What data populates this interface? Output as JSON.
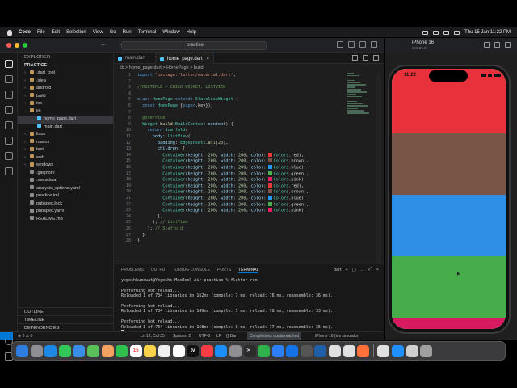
{
  "menubar": {
    "app": "Code",
    "items": [
      "File",
      "Edit",
      "Selection",
      "View",
      "Go",
      "Run",
      "Terminal",
      "Window",
      "Help"
    ],
    "datetime": "Thu 15 Jan  11:22 PM"
  },
  "titlebar": {
    "search": "practice"
  },
  "sidebar": {
    "header": "EXPLORER",
    "project": "PRACTICE",
    "tree": [
      {
        "label": ".dart_tool",
        "indent": 0,
        "folder": true
      },
      {
        "label": ".idea",
        "indent": 0,
        "folder": true
      },
      {
        "label": "android",
        "indent": 0,
        "folder": true
      },
      {
        "label": "build",
        "indent": 0,
        "folder": true
      },
      {
        "label": "ios",
        "indent": 0,
        "folder": true
      },
      {
        "label": "lib",
        "indent": 0,
        "folder": true,
        "open": true
      },
      {
        "label": "home_page.dart",
        "indent": 1,
        "selected": true
      },
      {
        "label": "main.dart",
        "indent": 1
      },
      {
        "label": "linux",
        "indent": 0,
        "folder": true
      },
      {
        "label": "macos",
        "indent": 0,
        "folder": true
      },
      {
        "label": "test",
        "indent": 0,
        "folder": true
      },
      {
        "label": "web",
        "indent": 0,
        "folder": true
      },
      {
        "label": "windows",
        "indent": 0,
        "folder": true
      },
      {
        "label": ".gitignore",
        "indent": 0
      },
      {
        "label": ".metadata",
        "indent": 0
      },
      {
        "label": "analysis_options.yaml",
        "indent": 0
      },
      {
        "label": "practice.iml",
        "indent": 0
      },
      {
        "label": "pubspec.lock",
        "indent": 0
      },
      {
        "label": "pubspec.yaml",
        "indent": 0
      },
      {
        "label": "README.md",
        "indent": 0
      }
    ],
    "outline": "OUTLINE",
    "timeline": "TIMELINE",
    "dependencies": "DEPENDENCIES"
  },
  "tabs": [
    {
      "label": "main.dart",
      "active": false
    },
    {
      "label": "home_page.dart",
      "active": true
    }
  ],
  "breadcrumb": "lib > home_page.dart > HomePage > build",
  "code": {
    "lines": [
      {
        "n": "1",
        "html": "<span class='kw'>import</span> <span class='str'>'package:flutter/material.dart'</span>;"
      },
      {
        "n": "2",
        "html": ""
      },
      {
        "n": "3",
        "html": "<span class='cm'>//MULTIPLE — CHILD WIDGET: LISTVIEW</span>"
      },
      {
        "n": "4",
        "html": ""
      },
      {
        "n": "5",
        "html": "<span class='kw'>class</span> <span class='ty'>HomePage</span> <span class='kw'>extends</span> <span class='ty'>StatelessWidget</span> {"
      },
      {
        "n": "6",
        "html": "  <span class='kw'>const</span> <span class='ty'>HomePage</span>({<span class='kw'>super</span>.key});"
      },
      {
        "n": "7",
        "html": ""
      },
      {
        "n": "8",
        "html": "  <span class='cm'>@override</span>"
      },
      {
        "n": "9",
        "html": "  <span class='ty'>Widget</span> <span class='fn'>build</span>(<span class='ty'>BuildContext</span> <span class='pr'>context</span>) {"
      },
      {
        "n": "10",
        "html": "    <span class='kw'>return</span> <span class='ty'>Scaffold</span>("
      },
      {
        "n": "11",
        "html": "      <span class='pr'>body</span>: <span class='ty'>ListView</span>("
      },
      {
        "n": "12",
        "html": "        <span class='pr'>padding</span>: <span class='ty'>EdgeInsets</span>.<span class='fn'>all</span>(<span class='num'>20</span>),"
      },
      {
        "n": "13",
        "html": "        <span class='pr'>children</span>: ["
      },
      {
        "n": "14",
        "html": "          <span class='ty'>Container</span>(<span class='pr'>height</span>: <span class='num'>200</span>, <span class='pr'>width</span>: <span class='num'>200</span>, <span class='pr'>color</span>: <i class='swatch' style='background:#e53935'></i><span class='ty'>Colors</span>.red),"
      },
      {
        "n": "15",
        "html": "          <span class='ty'>Container</span>(<span class='pr'>height</span>: <span class='num'>200</span>, <span class='pr'>width</span>: <span class='num'>200</span>, <span class='pr'>color</span>: <i class='swatch' style='background:#795548'></i><span class='ty'>Colors</span>.brown),"
      },
      {
        "n": "16",
        "html": "          <span class='ty'>Container</span>(<span class='pr'>height</span>: <span class='num'>200</span>, <span class='pr'>width</span>: <span class='num'>200</span>, <span class='pr'>color</span>: <i class='swatch' style='background:#2196f3'></i><span class='ty'>Colors</span>.blue),"
      },
      {
        "n": "17",
        "html": "          <span class='ty'>Container</span>(<span class='pr'>height</span>: <span class='num'>200</span>, <span class='pr'>width</span>: <span class='num'>200</span>, <span class='pr'>color</span>: <i class='swatch' style='background:#4caf50'></i><span class='ty'>Colors</span>.green),"
      },
      {
        "n": "18",
        "html": "          <span class='ty'>Container</span>(<span class='pr'>height</span>: <span class='num'>200</span>, <span class='pr'>width</span>: <span class='num'>200</span>, <span class='pr'>color</span>: <i class='swatch' style='background:#e91e63'></i><span class='ty'>Colors</span>.pink),"
      },
      {
        "n": "19",
        "html": "          <span class='ty'>Container</span>(<span class='pr'>height</span>: <span class='num'>200</span>, <span class='pr'>width</span>: <span class='num'>200</span>, <span class='pr'>color</span>: <i class='swatch' style='background:#e53935'></i><span class='ty'>Colors</span>.red),"
      },
      {
        "n": "20",
        "html": "          <span class='ty'>Container</span>(<span class='pr'>height</span>: <span class='num'>200</span>, <span class='pr'>width</span>: <span class='num'>200</span>, <span class='pr'>color</span>: <i class='swatch' style='background:#795548'></i><span class='ty'>Colors</span>.brown),"
      },
      {
        "n": "21",
        "html": "          <span class='ty'>Container</span>(<span class='pr'>height</span>: <span class='num'>200</span>, <span class='pr'>width</span>: <span class='num'>200</span>, <span class='pr'>color</span>: <i class='swatch' style='background:#2196f3'></i><span class='ty'>Colors</span>.blue),"
      },
      {
        "n": "22",
        "html": "          <span class='ty'>Container</span>(<span class='pr'>height</span>: <span class='num'>200</span>, <span class='pr'>width</span>: <span class='num'>200</span>, <span class='pr'>color</span>: <i class='swatch' style='background:#4caf50'></i><span class='ty'>Colors</span>.green),"
      },
      {
        "n": "23",
        "html": "          <span class='ty'>Container</span>(<span class='pr'>height</span>: <span class='num'>200</span>, <span class='pr'>width</span>: <span class='num'>200</span>, <span class='pr'>color</span>: <i class='swatch' style='background:#e91e63'></i><span class='ty'>Colors</span>.pink),"
      },
      {
        "n": "24",
        "html": "        ],"
      },
      {
        "n": "25",
        "html": "      ), <span class='cm'>// ListView</span>"
      },
      {
        "n": "26",
        "html": "    ); <span class='cm'>// Scaffold</span>"
      },
      {
        "n": "27",
        "html": "  }"
      },
      {
        "n": "28",
        "html": "}"
      }
    ]
  },
  "panel": {
    "tabs": [
      "PROBLEMS",
      "OUTPUT",
      "DEBUG CONSOLE",
      "PORTS",
      "TERMINAL"
    ],
    "active_tab": "TERMINAL",
    "shell": "dart",
    "terminal_lines": [
      "yogeshkumawat@Yogeshs-MacBook-Air practice % flutter run",
      "",
      "Performing hot reload...",
      "Reloaded 1 of 734 libraries in 162ms (compile: 7 ms, reload: 76 ms, reassemble: 36 ms).",
      "",
      "Performing hot reload...",
      "Reloaded 1 of 734 libraries in 149ms (compile: 5 ms, reload: 78 ms, reassemble: 33 ms).",
      "",
      "Performing hot reload...",
      "Reloaded 1 of 734 libraries in 158ms (compile: 8 ms, reload: 77 ms, reassemble: 35 ms)."
    ]
  },
  "statusbar": {
    "errors": "⊗ 0 ⚠ 0",
    "position": "Ln 12, Col 35",
    "spaces": "Spaces: 2",
    "encoding": "UTF-8",
    "eol": "LF",
    "lang": "{} Dart",
    "quota": "Completions quota reached",
    "device": "iPhone 16 (ios simulator)"
  },
  "simulator": {
    "title": "iPhone 16",
    "subtitle": "iOS 26.0",
    "time": "11:22",
    "list_colors": [
      "#e8313a",
      "#795548",
      "#2f8fe6",
      "#47ad4a",
      "#d81b60"
    ]
  },
  "dock": {
    "apps": [
      {
        "name": "finder",
        "color": "#2f7de1",
        "label": ""
      },
      {
        "name": "launchpad",
        "color": "#8e8e93",
        "label": ""
      },
      {
        "name": "safari",
        "color": "#1e88e5",
        "label": ""
      },
      {
        "name": "messages",
        "color": "#34c759",
        "label": ""
      },
      {
        "name": "mail",
        "color": "#3a8ee6",
        "label": ""
      },
      {
        "name": "maps",
        "color": "#5ac05a",
        "label": ""
      },
      {
        "name": "photos",
        "color": "#f4a261",
        "label": ""
      },
      {
        "name": "facetime",
        "color": "#30c04f",
        "label": ""
      },
      {
        "name": "calendar",
        "color": "#ffffff",
        "label": "15"
      },
      {
        "name": "notes",
        "color": "#f7d24a",
        "label": ""
      },
      {
        "name": "reminders",
        "color": "#f0f0f0",
        "label": ""
      },
      {
        "name": "freeform",
        "color": "#ffffff",
        "label": ""
      },
      {
        "name": "tv",
        "color": "#111111",
        "label": "tv"
      },
      {
        "name": "music",
        "color": "#fc3c44",
        "label": ""
      },
      {
        "name": "appstore",
        "color": "#1c8ef9",
        "label": ""
      },
      {
        "name": "settings",
        "color": "#8e8e93",
        "label": ""
      },
      {
        "name": "terminal",
        "color": "#2b2b2b",
        "label": ">_"
      },
      {
        "name": "numbers",
        "color": "#2fb24c",
        "label": ""
      },
      {
        "name": "keynote",
        "color": "#2d7ff9",
        "label": ""
      },
      {
        "name": "xcode",
        "color": "#1572e8",
        "label": ""
      },
      {
        "name": "simulator",
        "color": "#555555",
        "label": ""
      },
      {
        "name": "vscode",
        "color": "#1e5fa8",
        "label": ""
      },
      {
        "name": "chrome",
        "color": "#e0e0e0",
        "label": ""
      },
      {
        "name": "chrome-2",
        "color": "#e0e0e0",
        "label": ""
      },
      {
        "name": "firefox",
        "color": "#ff7139",
        "label": ""
      },
      {
        "name": "sep",
        "color": "",
        "label": ""
      },
      {
        "name": "chrome-app",
        "color": "#e0e0e0",
        "label": ""
      },
      {
        "name": "downloads",
        "color": "#1e90ff",
        "label": ""
      },
      {
        "name": "preview",
        "color": "#d0d0d0",
        "label": ""
      },
      {
        "name": "trash",
        "color": "#a0a0a0",
        "label": ""
      }
    ]
  }
}
